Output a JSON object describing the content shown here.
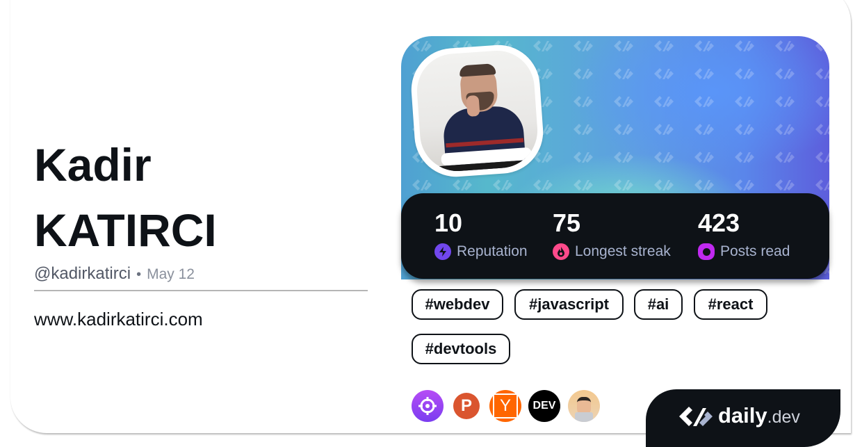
{
  "profile": {
    "first_name": "Kadir",
    "last_name": "KATIRCI",
    "username": "@kadirkatirci",
    "separator": "•",
    "joined": "May 12",
    "website": "www.kadirkatirci.com"
  },
  "stats": [
    {
      "value": "10",
      "label": "Reputation",
      "icon": "lightning-icon",
      "color": "#7147ed"
    },
    {
      "value": "75",
      "label": "Longest streak",
      "icon": "flame-icon",
      "color": "#ff4a8b"
    },
    {
      "value": "423",
      "label": "Posts read",
      "icon": "eye-icon",
      "color": "#c029f0"
    }
  ],
  "tags": [
    "#webdev",
    "#javascript",
    "#ai",
    "#react",
    "#devtools"
  ],
  "sources": [
    {
      "name": "crosshair-source",
      "label": "",
      "color": "#8c3cf0"
    },
    {
      "name": "producthunt-source",
      "label": "P",
      "color": "#da552f"
    },
    {
      "name": "hackernews-source",
      "label": "Y",
      "color": "#ff6600"
    },
    {
      "name": "devto-source",
      "label": "DEV",
      "color": "#000000"
    },
    {
      "name": "devsquad-source",
      "label": "",
      "color": "#f0c995"
    }
  ],
  "brand": {
    "name": "daily",
    "tld": ".dev"
  },
  "colors": {
    "text_dark": "#0e1217",
    "stats_bg": "#0e1217",
    "stat_label": "#a8b3cf"
  }
}
